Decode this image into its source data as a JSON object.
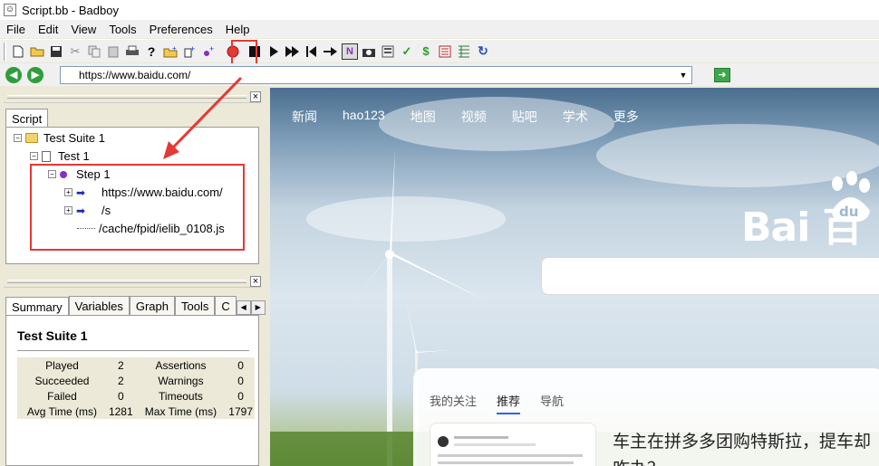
{
  "window": {
    "title": "Script.bb - Badboy"
  },
  "menu": [
    "File",
    "Edit",
    "View",
    "Tools",
    "Preferences",
    "Help"
  ],
  "toolbar": {
    "icons": [
      "new-icon",
      "open-icon",
      "save-icon",
      "cut-icon",
      "copy-icon",
      "paste-icon",
      "print-icon",
      "help-icon",
      "add-suite-icon",
      "add-test-icon",
      "add-step-icon",
      "record-icon",
      "stop-icon",
      "play-icon",
      "play-all-icon",
      "rewind-icon",
      "skip-icon",
      "navigation-icon",
      "screenshot-icon",
      "report-icon",
      "assertion-icon",
      "variable-icon",
      "calendar-icon",
      "spreadsheet-icon",
      "refresh-icon"
    ],
    "colors": {
      "record": "#e53935",
      "highlight": "#e53935"
    }
  },
  "address": {
    "url": "https://www.baidu.com/"
  },
  "script_panel": {
    "tab": "Script",
    "tree": [
      {
        "label": "Test Suite 1",
        "level": 0,
        "type": "suite"
      },
      {
        "label": "Test 1",
        "level": 1,
        "type": "test"
      },
      {
        "label": "Step 1",
        "level": 2,
        "type": "step"
      },
      {
        "label": "https://www.baidu.com/",
        "level": 3,
        "type": "request"
      },
      {
        "label": "/s",
        "level": 3,
        "type": "request"
      },
      {
        "label": "/cache/fpid/ielib_0108.js",
        "level": 3,
        "type": "resource"
      }
    ]
  },
  "summary_panel": {
    "tabs": [
      "Summary",
      "Variables",
      "Graph",
      "Tools",
      "C"
    ],
    "title": "Test Suite 1",
    "stats": [
      {
        "l1": "Played",
        "v1": "2",
        "l2": "Assertions",
        "v2": "0"
      },
      {
        "l1": "Succeeded",
        "v1": "2",
        "l2": "Warnings",
        "v2": "0"
      },
      {
        "l1": "Failed",
        "v1": "0",
        "l2": "Timeouts",
        "v2": "0"
      },
      {
        "l1": "Avg Time (ms)",
        "v1": "1281",
        "l2": "Max Time (ms)",
        "v2": "1797"
      }
    ]
  },
  "browser": {
    "nav": [
      "新闻",
      "hao123",
      "地图",
      "视频",
      "贴吧",
      "学术",
      "更多"
    ],
    "logo": "Bai  百",
    "logo_du": "du",
    "feed_tabs": [
      "我的关注",
      "推荐",
      "导航"
    ],
    "headline1": "车主在拼多多团购特斯拉，提车却",
    "headline2": "咋办？"
  }
}
